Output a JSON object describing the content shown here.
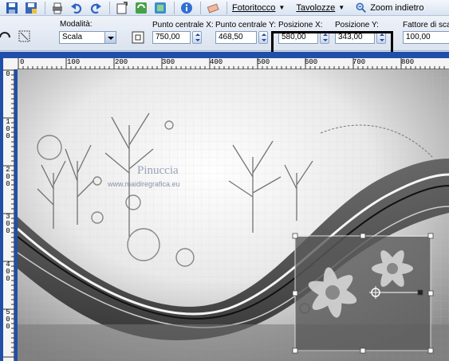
{
  "toolbar": {
    "icons": [
      "save-icon",
      "save-as-icon",
      "print-icon",
      "undo-icon",
      "redo-icon",
      "new-image-icon",
      "refresh-icon",
      "copy-icon",
      "info-icon",
      "eraser-icon",
      "zoom-icon"
    ],
    "menus": [
      {
        "label": "Fotoritocco"
      },
      {
        "label": "Tavolozze"
      }
    ],
    "zoom_out_label": "Zoom indietro"
  },
  "options": {
    "mode_label": "Modalità:",
    "mode_value": "Scala",
    "center_x_label": "Punto centrale X:",
    "center_x_value": "750,00",
    "center_y_label": "Punto centrale Y:",
    "center_y_value": "468,50",
    "pos_x_label": "Posizione X:",
    "pos_x_value": "580,00",
    "pos_y_label": "Posizione Y:",
    "pos_y_value": "343,00",
    "scale_label": "Fattore di scal",
    "scale_value": "100,00"
  },
  "ruler": {
    "top_labels": [
      "0",
      "100",
      "200",
      "300",
      "400",
      "500",
      "600",
      "700",
      "800"
    ],
    "left_labels": [
      "0",
      "100",
      "200",
      "300",
      "400",
      "500"
    ]
  },
  "canvas": {
    "watermark_title": "Pinuccia",
    "watermark_url": "www.maidiregrafica.eu"
  },
  "colors": {
    "workspace": "#1f4fa8",
    "highlight_border": "#000000"
  }
}
